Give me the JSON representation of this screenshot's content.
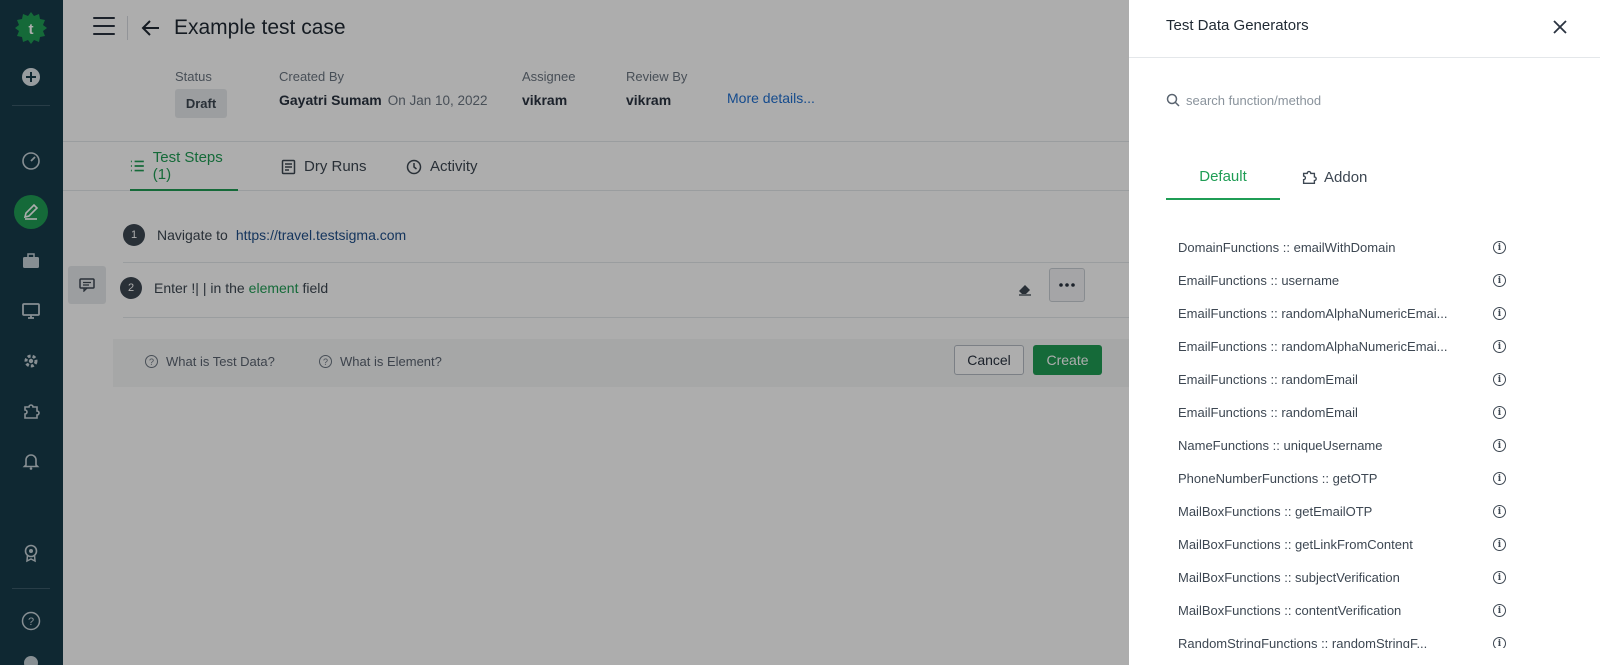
{
  "page": {
    "title": "Example test case"
  },
  "meta": {
    "status_label": "Status",
    "status_value": "Draft",
    "created_by_label": "Created By",
    "created_by_name": "Gayatri Sumam",
    "created_on": "On Jan 10, 2022",
    "assignee_label": "Assignee",
    "assignee_value": "vikram",
    "review_by_label": "Review By",
    "review_by_value": "vikram",
    "more_details": "More details..."
  },
  "tabs": [
    {
      "label": "Test Steps (1)",
      "icon": "list-icon",
      "active": true
    },
    {
      "label": "Dry Runs",
      "icon": "document-icon",
      "active": false
    },
    {
      "label": "Activity",
      "icon": "clock-icon",
      "active": false
    }
  ],
  "steps": [
    {
      "num": "1",
      "text": "Navigate to",
      "link": "https://travel.testsigma.com"
    },
    {
      "num": "2",
      "prefix": "Enter !|",
      "mid": "| in the",
      "element": "element",
      "suffix": "field"
    }
  ],
  "help": {
    "test_data": "What is Test Data?",
    "element": "What is Element?",
    "cancel": "Cancel",
    "create": "Create"
  },
  "drawer": {
    "title": "Test Data Generators",
    "search_placeholder": "search function/method",
    "tabs": [
      {
        "label": "Default",
        "active": true
      },
      {
        "label": "Addon",
        "active": false
      }
    ],
    "functions": [
      "DomainFunctions :: emailWithDomain",
      "EmailFunctions :: username",
      "EmailFunctions :: randomAlphaNumericEmai...",
      "EmailFunctions :: randomAlphaNumericEmai...",
      "EmailFunctions :: randomEmail",
      "EmailFunctions :: randomEmail",
      "NameFunctions :: uniqueUsername",
      "PhoneNumberFunctions :: getOTP",
      "MailBoxFunctions :: getEmailOTP",
      "MailBoxFunctions :: getLinkFromContent",
      "MailBoxFunctions :: subjectVerification",
      "MailBoxFunctions :: contentVerification",
      "RandomStringFunctions :: randomStringF..."
    ]
  },
  "colors": {
    "accent": "#1f9d55",
    "rail": "#173b4a",
    "link": "#1f6fd0"
  }
}
